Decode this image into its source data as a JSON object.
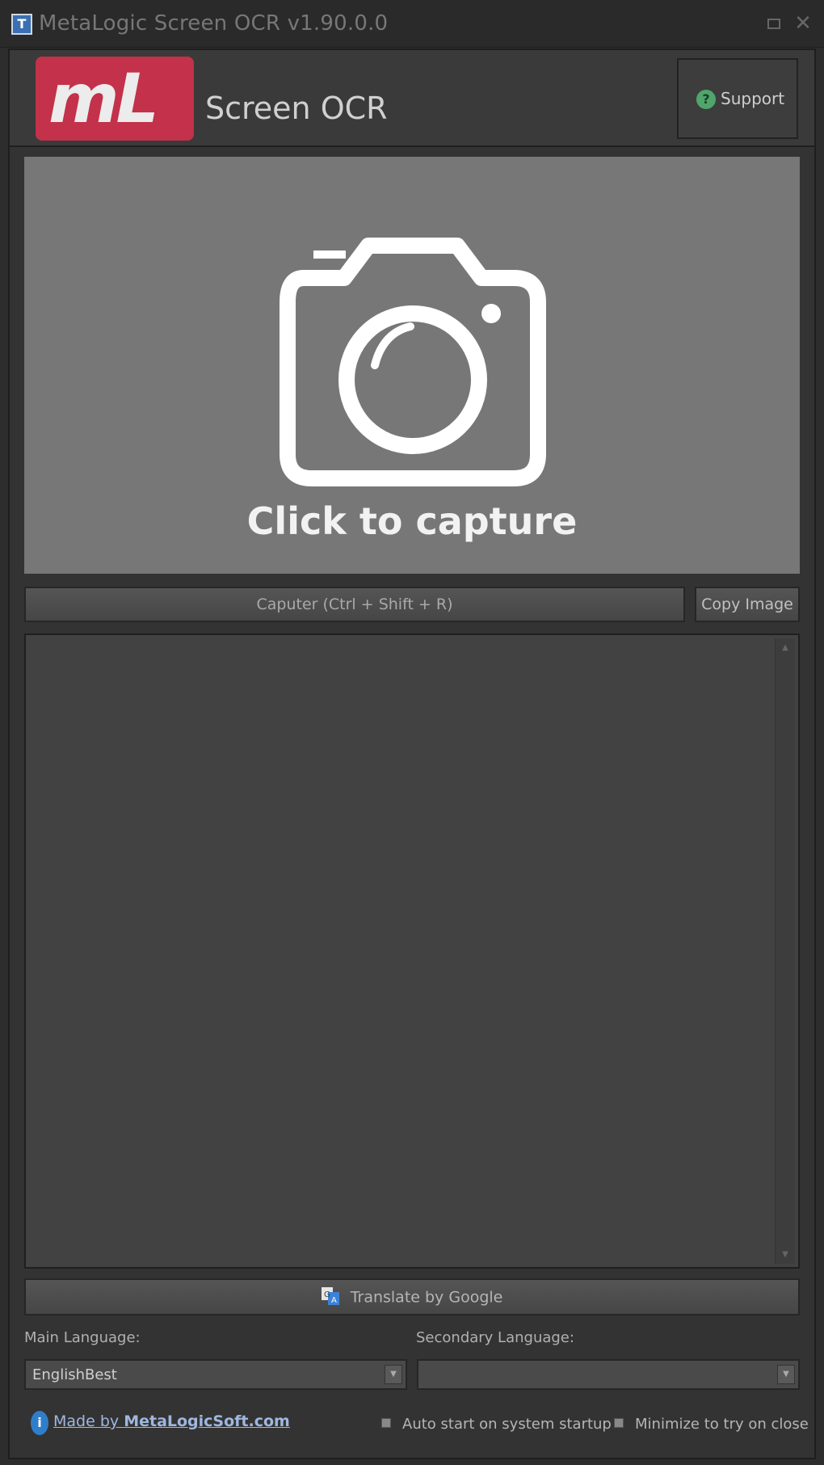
{
  "window": {
    "title": "MetaLogic Screen OCR v1.90.0.0"
  },
  "header": {
    "logo_text": "mL",
    "app_name": "Screen OCR",
    "support_label": "Support",
    "support_icon_glyph": "?"
  },
  "capture": {
    "label": "Click to capture",
    "capture_button": "Caputer (Ctrl + Shift + R)",
    "copy_button": "Copy Image"
  },
  "output": {
    "text": ""
  },
  "translate": {
    "label": "Translate by Google"
  },
  "languages": {
    "main_label": "Main Language:",
    "main_value": "EnglishBest",
    "secondary_label": "Secondary Language:",
    "secondary_value": ""
  },
  "footer": {
    "made_by_prefix": "Made by",
    "made_by_link": "MetaLogicSoft.com",
    "auto_start_label": "Auto start on system startup",
    "minimize_label": "Minimize to try on close"
  },
  "colors": {
    "logo_bg": "#c3314a",
    "capture_bg": "#777777",
    "support_icon": "#4fa56b",
    "footer_icon": "#2f7ec9"
  }
}
